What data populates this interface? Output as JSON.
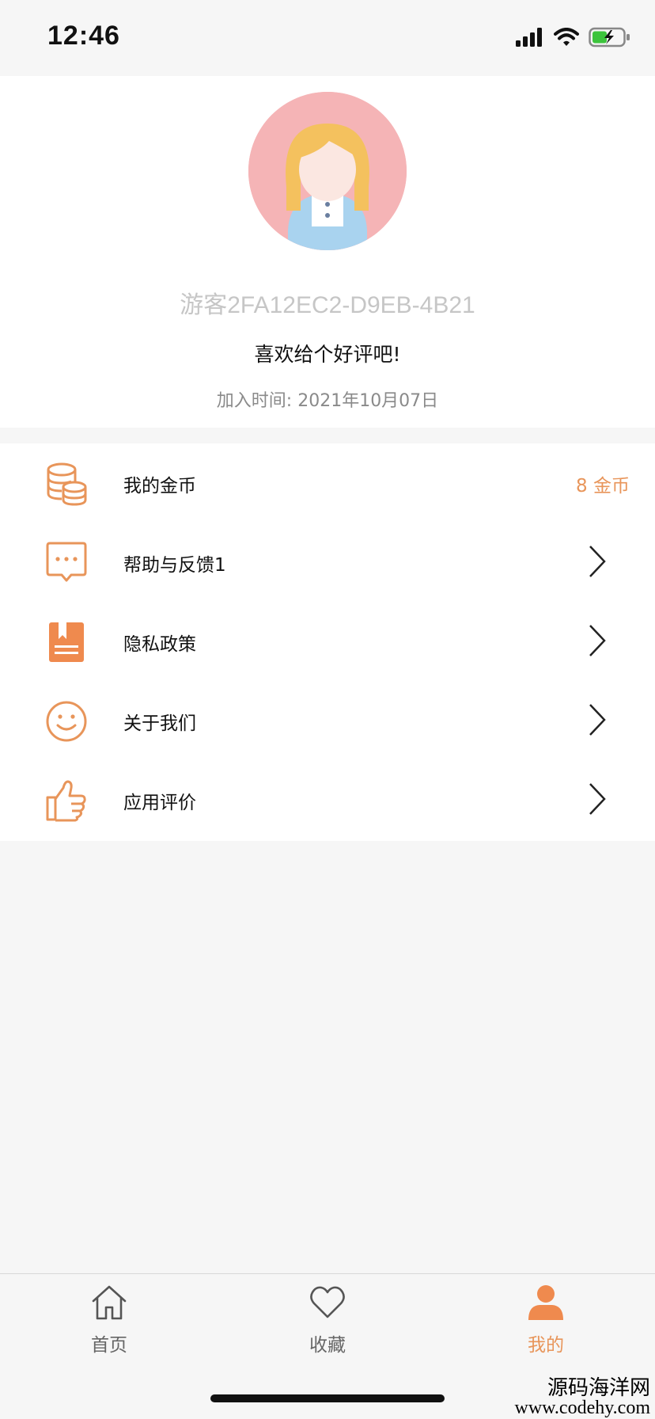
{
  "status_bar": {
    "time": "12:46"
  },
  "profile": {
    "name": "游客2FA12EC2-D9EB-4B21",
    "motto": "喜欢给个好评吧!",
    "join_date": "加入时间: 2021年10月07日"
  },
  "menu": {
    "items": [
      {
        "label": "我的金币",
        "value": "8 金币",
        "icon": "coins-icon"
      },
      {
        "label": "帮助与反馈1",
        "icon": "message-icon"
      },
      {
        "label": "隐私政策",
        "icon": "book-icon"
      },
      {
        "label": "关于我们",
        "icon": "smile-icon"
      },
      {
        "label": "应用评价",
        "icon": "thumbs-up-icon"
      }
    ]
  },
  "tabs": [
    {
      "label": "首页",
      "icon": "home-icon"
    },
    {
      "label": "收藏",
      "icon": "heart-icon"
    },
    {
      "label": "我的",
      "icon": "user-icon",
      "active": true
    }
  ],
  "watermark": {
    "name": "源码海洋网",
    "url": "www.codehy.com"
  },
  "colors": {
    "accent": "#e8955a",
    "avatar_bg": "#f5b4b6"
  }
}
